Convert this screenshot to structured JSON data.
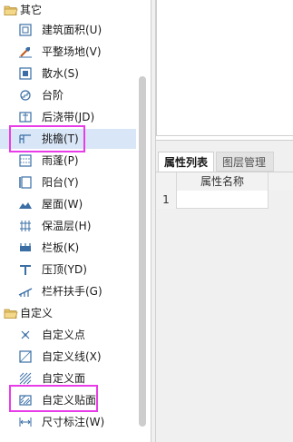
{
  "tree": {
    "groups": [
      {
        "label": "其它"
      },
      {
        "label": "自定义"
      }
    ],
    "items": [
      {
        "label": "建筑面积(U)"
      },
      {
        "label": "平整场地(V)"
      },
      {
        "label": "散水(S)"
      },
      {
        "label": "台阶"
      },
      {
        "label": "后浇带(JD)"
      },
      {
        "label": "挑檐(T)"
      },
      {
        "label": "雨蓬(P)"
      },
      {
        "label": "阳台(Y)"
      },
      {
        "label": "屋面(W)"
      },
      {
        "label": "保温层(H)"
      },
      {
        "label": "栏板(K)"
      },
      {
        "label": "压顶(YD)"
      },
      {
        "label": "栏杆扶手(G)"
      },
      {
        "label": "自定义点"
      },
      {
        "label": "自定义线(X)"
      },
      {
        "label": "自定义面"
      },
      {
        "label": "自定义贴面"
      },
      {
        "label": "尺寸标注(W)"
      }
    ]
  },
  "properties": {
    "tabs": [
      {
        "label": "属性列表"
      },
      {
        "label": "图层管理"
      }
    ],
    "column_header": "属性名称",
    "row_number": "1"
  },
  "colors": {
    "highlight": "#e83ce8",
    "selected_row": "#d9e6f7",
    "icon_blue": "#3a6ea5",
    "folder": "#e8c56a"
  }
}
